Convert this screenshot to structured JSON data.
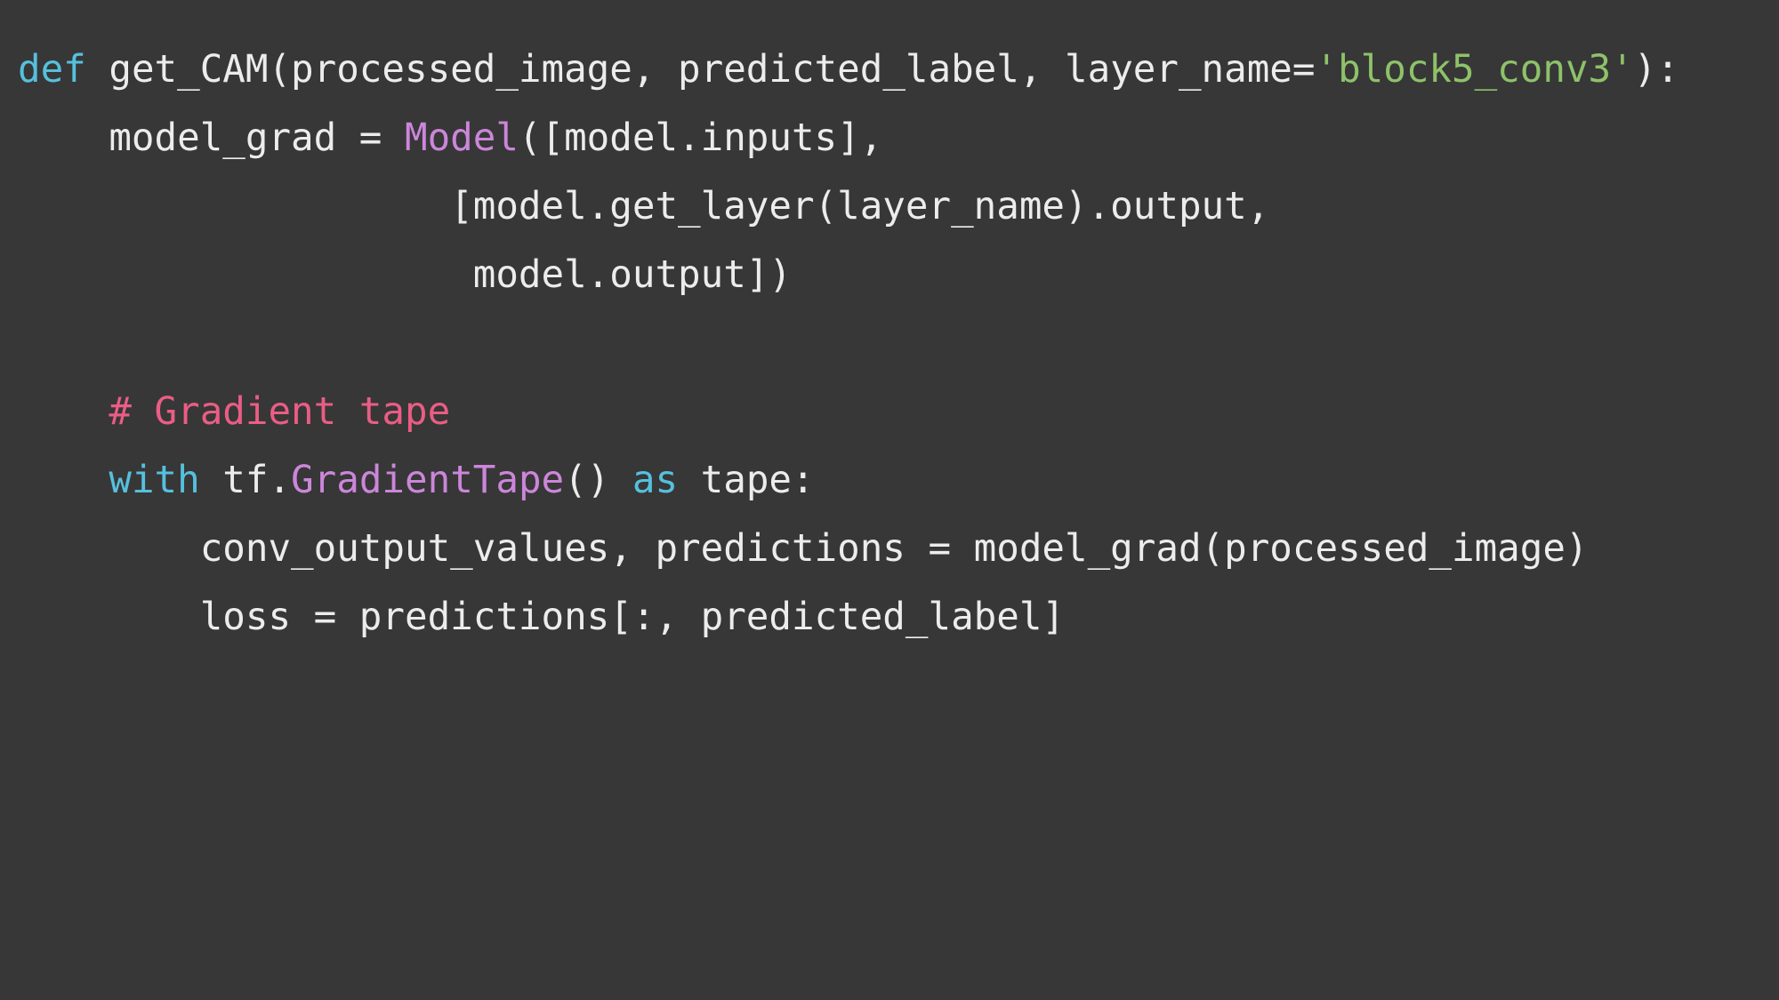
{
  "colors": {
    "background": "#373737",
    "text": "#ececec",
    "keyword": "#56c0dd",
    "class": "#cc86da",
    "string": "#8ec26a",
    "comment": "#ea5d84"
  },
  "code": {
    "lines": [
      [
        {
          "t": "def",
          "k": "keyword"
        },
        {
          "t": " get_CAM(processed_image, predicted_label, layer_name=",
          "k": "plain"
        },
        {
          "t": "'block5_conv3'",
          "k": "string"
        },
        {
          "t": "):",
          "k": "plain"
        }
      ],
      [
        {
          "t": "    model_grad = ",
          "k": "plain"
        },
        {
          "t": "Model",
          "k": "class"
        },
        {
          "t": "([model.inputs],",
          "k": "plain"
        }
      ],
      [
        {
          "t": "                   [model.get_layer(layer_name).output,",
          "k": "plain"
        }
      ],
      [
        {
          "t": "                    model.output])",
          "k": "plain"
        }
      ],
      [],
      [
        {
          "t": "    ",
          "k": "plain"
        },
        {
          "t": "# Gradient tape",
          "k": "comment"
        }
      ],
      [
        {
          "t": "    ",
          "k": "plain"
        },
        {
          "t": "with",
          "k": "keyword"
        },
        {
          "t": " tf.",
          "k": "plain"
        },
        {
          "t": "GradientTape",
          "k": "class"
        },
        {
          "t": "() ",
          "k": "plain"
        },
        {
          "t": "as",
          "k": "keyword"
        },
        {
          "t": " tape:",
          "k": "plain"
        }
      ],
      [
        {
          "t": "        conv_output_values, predictions = model_grad(processed_image)",
          "k": "plain"
        }
      ],
      [
        {
          "t": "        loss = predictions[:, predicted_label]",
          "k": "plain"
        }
      ]
    ]
  }
}
